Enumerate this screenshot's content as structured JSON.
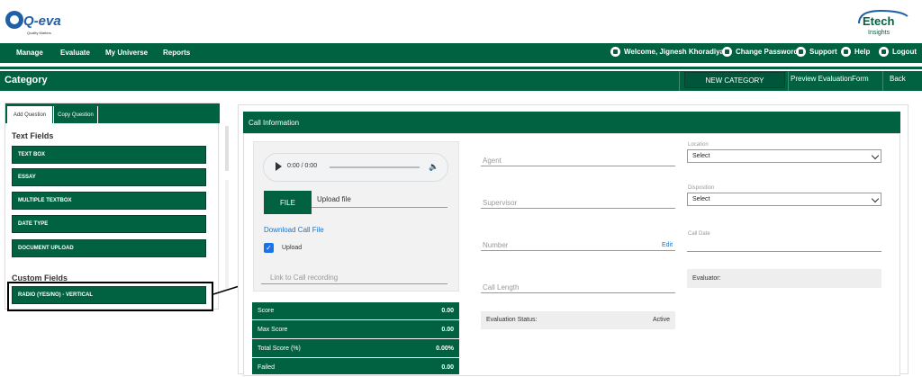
{
  "brand": {
    "left_logo": "Q-eval",
    "left_tagline": "Quality Matters",
    "right_logo": "Etech",
    "right_tagline": "Insights"
  },
  "nav": {
    "items": [
      "Manage",
      "Evaluate",
      "My Universe",
      "Reports"
    ],
    "welcome": "Welcome, Jignesh Khoradiya",
    "change_password": "Change Password",
    "support": "Support",
    "help": "Help",
    "logout": "Logout"
  },
  "category_bar": {
    "title": "Category",
    "new_category": "NEW CATEGORY",
    "preview": "Preview EvaluationForm",
    "back": "Back"
  },
  "left_panel": {
    "tabs": [
      "Add Question",
      "Copy Question"
    ],
    "text_fields_title": "Text Fields",
    "text_fields": [
      "TEXT BOX",
      "ESSAY",
      "MULTIPLE TEXTBOX",
      "DATE TYPE",
      "DOCUMENT UPLOAD"
    ],
    "custom_fields_title": "Custom Fields",
    "custom_fields": [
      "RADIO (YES/NO) - VERTICAL"
    ]
  },
  "call_info": {
    "title": "Call Information",
    "audio_time": "0:00 / 0:00",
    "file_button": "FILE",
    "upload_file": "Upload file",
    "download_link": "Download Call File",
    "upload_checkbox_label": "Upload",
    "upload_checked": true,
    "link_recording_placeholder": "Link to Call recording",
    "agent_label": "Agent",
    "supervisor_label": "Supervisor",
    "number_label": "Number",
    "edit_link": "Edit",
    "call_length_label": "Call Length",
    "evaluation_status_label": "Evaluation Status:",
    "evaluation_status_value": "Active",
    "location_label": "Location",
    "location_value": "Select",
    "disposition_label": "Disposition",
    "disposition_value": "Select",
    "call_date_label": "Call Date",
    "evaluator_label": "Evaluator:"
  },
  "scores": [
    {
      "label": "Score",
      "value": "0.00"
    },
    {
      "label": "Max Score",
      "value": "0.00"
    },
    {
      "label": "Total Score (%)",
      "value": "0.00%"
    },
    {
      "label": "Failed",
      "value": "0.00"
    }
  ],
  "colors": {
    "brand_green": "#006241",
    "link_blue": "#1a73c8",
    "checkbox_blue": "#1a73e8"
  }
}
